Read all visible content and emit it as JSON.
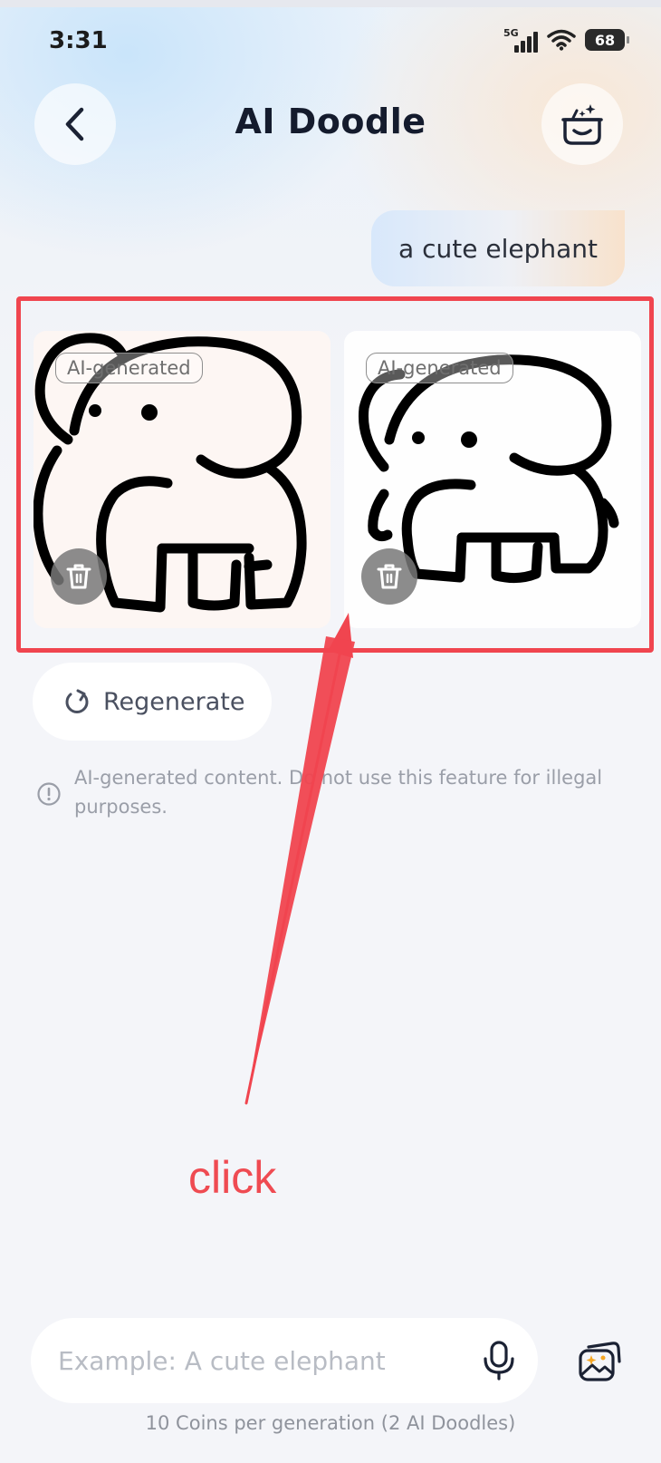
{
  "status_bar": {
    "time": "3:31",
    "network": "5G",
    "battery": "68"
  },
  "header": {
    "title": "AI Doodle"
  },
  "chat": {
    "user_prompt": "a cute elephant",
    "images": [
      {
        "badge": "AI-generated"
      },
      {
        "badge": "AI-generated"
      }
    ],
    "regenerate_label": "Regenerate",
    "notice": "AI-generated content. Do not use this feature for illegal purposes."
  },
  "annotation": {
    "label": "click",
    "color": "#f0454f"
  },
  "composer": {
    "placeholder": "Example: A cute elephant",
    "cost_note": "10 Coins per generation (2 AI Doodles)"
  },
  "icons": {
    "back": "chevron-left-icon",
    "kit": "sparkle-box-icon",
    "trash": "trash-icon",
    "regenerate": "refresh-icon",
    "notice": "info-icon",
    "mic": "microphone-icon",
    "gallery": "gallery-icon"
  }
}
